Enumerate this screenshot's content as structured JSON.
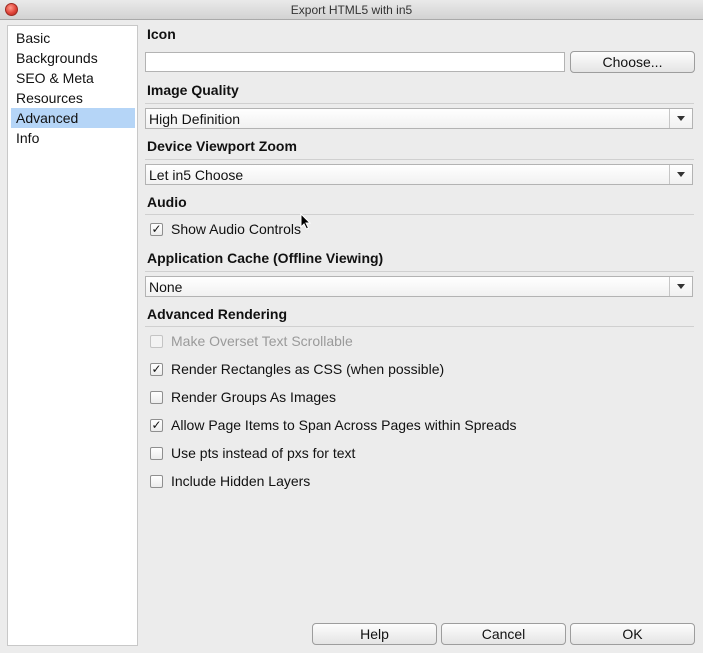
{
  "window": {
    "title": "Export HTML5 with in5"
  },
  "sidebar": {
    "items": [
      {
        "label": "Basic"
      },
      {
        "label": "Backgrounds"
      },
      {
        "label": "SEO & Meta"
      },
      {
        "label": "Resources"
      },
      {
        "label": "Advanced",
        "selected": true
      },
      {
        "label": "Info"
      }
    ]
  },
  "icon": {
    "title": "Icon",
    "value": "",
    "choose_label": "Choose..."
  },
  "image_quality": {
    "title": "Image Quality",
    "value": "High Definition"
  },
  "viewport_zoom": {
    "title": "Device Viewport Zoom",
    "value": "Let in5 Choose"
  },
  "audio": {
    "title": "Audio",
    "show_controls": {
      "label": "Show Audio Controls",
      "checked": true
    }
  },
  "app_cache": {
    "title": "Application Cache (Offline Viewing)",
    "value": "None"
  },
  "rendering": {
    "title": "Advanced Rendering",
    "options": [
      {
        "label": "Make Overset Text Scrollable",
        "checked": false,
        "enabled": false
      },
      {
        "label": "Render Rectangles as CSS (when possible)",
        "checked": true,
        "enabled": true
      },
      {
        "label": "Render Groups As Images",
        "checked": false,
        "enabled": true
      },
      {
        "label": "Allow Page Items to Span Across Pages within Spreads",
        "checked": true,
        "enabled": true
      },
      {
        "label": "Use pts instead of pxs for text",
        "checked": false,
        "enabled": true
      },
      {
        "label": "Include Hidden Layers",
        "checked": false,
        "enabled": true
      }
    ]
  },
  "footer": {
    "help_label": "Help",
    "cancel_label": "Cancel",
    "ok_label": "OK"
  },
  "check_glyph": "✓"
}
